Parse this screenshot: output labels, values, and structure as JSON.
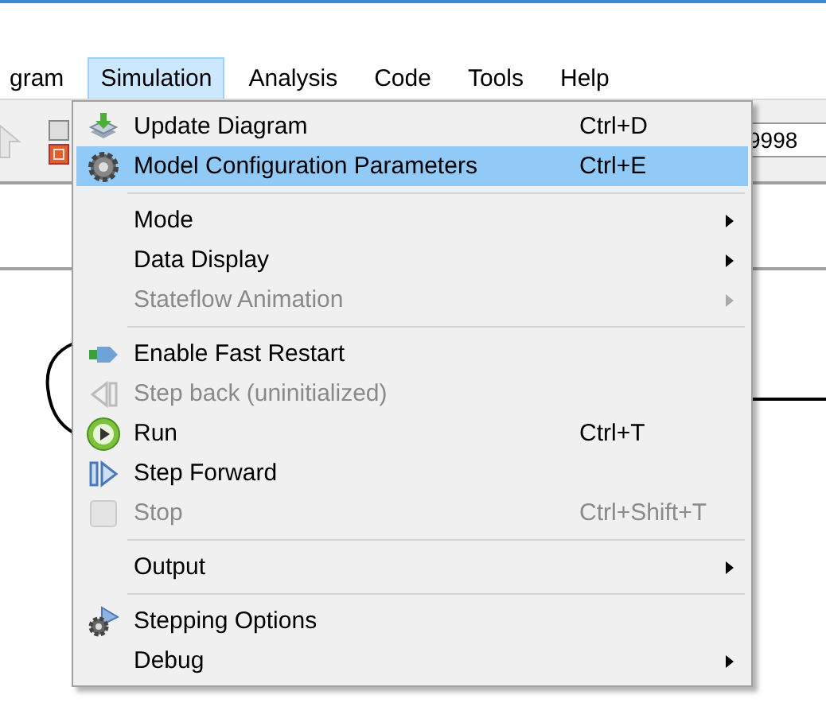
{
  "menu_bar": [
    {
      "label": "gram",
      "selected": false
    },
    {
      "label": "Simulation",
      "selected": true
    },
    {
      "label": "Analysis",
      "selected": false
    },
    {
      "label": "Code",
      "selected": false
    },
    {
      "label": "Tools",
      "selected": false
    },
    {
      "label": "Help",
      "selected": false
    }
  ],
  "toolbar": {
    "field_value": "9998"
  },
  "menu": [
    {
      "kind": "item",
      "label": "Update Diagram",
      "shortcut": "Ctrl+D",
      "submenu": false,
      "disabled": false,
      "selected": false
    },
    {
      "kind": "item",
      "label": "Model Configuration Parameters",
      "shortcut": "Ctrl+E",
      "submenu": false,
      "disabled": false,
      "selected": true
    },
    {
      "kind": "separator"
    },
    {
      "kind": "item",
      "label": "Mode",
      "submenu": true,
      "disabled": false,
      "selected": false
    },
    {
      "kind": "item",
      "label": "Data Display",
      "submenu": true,
      "disabled": false,
      "selected": false
    },
    {
      "kind": "item",
      "label": "Stateflow Animation",
      "submenu": true,
      "disabled": true,
      "selected": false
    },
    {
      "kind": "separator"
    },
    {
      "kind": "item",
      "label": "Enable Fast Restart",
      "submenu": false,
      "disabled": false,
      "selected": false
    },
    {
      "kind": "item",
      "label": "Step back (uninitialized)",
      "submenu": false,
      "disabled": true,
      "selected": false
    },
    {
      "kind": "item",
      "label": "Run",
      "shortcut": "Ctrl+T",
      "submenu": false,
      "disabled": false,
      "selected": false
    },
    {
      "kind": "item",
      "label": "Step Forward",
      "submenu": false,
      "disabled": false,
      "selected": false
    },
    {
      "kind": "item",
      "label": "Stop",
      "shortcut": "Ctrl+Shift+T",
      "submenu": false,
      "disabled": true,
      "selected": false
    },
    {
      "kind": "separator"
    },
    {
      "kind": "item",
      "label": "Output",
      "submenu": true,
      "disabled": false,
      "selected": false
    },
    {
      "kind": "separator"
    },
    {
      "kind": "item",
      "label": "Stepping Options",
      "submenu": false,
      "disabled": false,
      "selected": false
    },
    {
      "kind": "item",
      "label": "Debug",
      "submenu": true,
      "disabled": false,
      "selected": false
    }
  ]
}
